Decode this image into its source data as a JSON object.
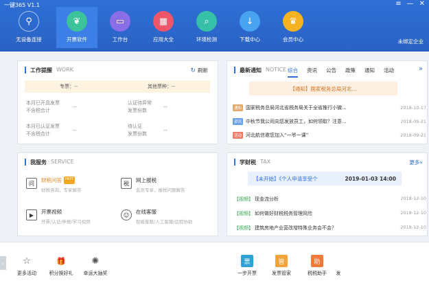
{
  "window": {
    "title": "一键365 V1.1",
    "controls": [
      "≡",
      "—",
      "✕"
    ]
  },
  "nav": [
    {
      "label": "无设备连接",
      "icon": "usb-icon",
      "color": "transparent"
    },
    {
      "label": "开票软件",
      "icon": "leaf-icon",
      "color": "#3cc39c"
    },
    {
      "label": "工作台",
      "icon": "monitor-icon",
      "color": "#8a6ee8"
    },
    {
      "label": "应用大全",
      "icon": "grid-icon",
      "color": "#f0566a"
    },
    {
      "label": "环境检测",
      "icon": "search-icon",
      "color": "#37c0a8"
    },
    {
      "label": "下载中心",
      "icon": "download-icon",
      "color": "#4aa3f0"
    },
    {
      "label": "会员中心",
      "icon": "vip-icon",
      "color": "#f5b321"
    }
  ],
  "user_status": "未绑定企业",
  "work": {
    "title": "工作提醒",
    "title_en": "WORK",
    "refresh": "刷新",
    "ticket_types": [
      "专票：--",
      "其他票种：--"
    ],
    "stats": [
      [
        "本月已开具发票",
        "不含税合计"
      ],
      [
        "认证待异常",
        "发票份数"
      ],
      [
        "本月已认证发票",
        "不含税合计"
      ],
      [
        "待认证",
        "发票份数"
      ]
    ],
    "dash": "--"
  },
  "service": {
    "title": "我服务",
    "title_en": "SERVICE",
    "hot": "HOT",
    "items": [
      {
        "name": "财税问答",
        "desc": "财税咨询，专家解答",
        "icon": "qa-icon",
        "glyph": "问"
      },
      {
        "name": "网上报税",
        "desc": "会员专享，报税问题解答",
        "icon": "tax-report-icon",
        "glyph": "税"
      },
      {
        "name": "开票视频",
        "desc": "开票/认证/申报/学习视频",
        "icon": "video-icon",
        "glyph": "▶"
      },
      {
        "name": "在线客服",
        "desc": "智能客服/人工客服/远程协助",
        "icon": "customer-service-icon",
        "glyph": "☺"
      }
    ]
  },
  "notice": {
    "title": "最新通知",
    "title_en": "NOTICE",
    "tabs": [
      "综合",
      "资讯",
      "公告",
      "政策",
      "通知",
      "活动"
    ],
    "chevron": "»",
    "banner": "【通知】国家税务总局河北...",
    "rows": [
      {
        "badge": "通知",
        "badge_color": "#e0a96d",
        "text": "国家税务总局河北省税务局关于全省推行小微...",
        "date": "2018-10-17"
      },
      {
        "badge": "资讯",
        "badge_color": "#6aa0e8",
        "text": "中秋节我公司向您发放员工，如何领取？注意...",
        "date": "2018-09-21"
      },
      {
        "badge": "活动",
        "badge_color": "#f07c6a",
        "text": "河北航信邀您加入“一爷一课”",
        "date": "2018-09-21"
      }
    ]
  },
  "tax": {
    "title": "学财税",
    "title_en": "TAX",
    "more": "更多»",
    "banner_left": "【未开始】《个人申请享受个",
    "banner_right": "2019-01-03 14:00",
    "rows": [
      {
        "cat": "【视频】",
        "text": "现金流分析",
        "date": "2018-12-10"
      },
      {
        "cat": "【视频】",
        "text": "如何做好财税税务管理风险",
        "date": "2018-12-10"
      },
      {
        "cat": "【视频】",
        "text": "建筑房地产业营改增特殊业务会不会？",
        "date": "2018-12-10"
      }
    ]
  },
  "bottom": {
    "arrow": "›",
    "left_items": [
      {
        "label": "更多活动",
        "icon": "star-icon",
        "glyph": "☆"
      },
      {
        "label": "积分换好礼",
        "icon": "gift-icon",
        "glyph": "🎁"
      },
      {
        "label": "幸运大抽奖",
        "icon": "wheel-icon",
        "glyph": "✺"
      }
    ],
    "right_items": [
      {
        "label": "一步开票",
        "icon": "invoice-icon",
        "color": "#2fa2d8",
        "glyph": "票"
      },
      {
        "label": "发票管家",
        "icon": "manager-icon",
        "color": "#f0a43a",
        "glyph": "管"
      },
      {
        "label": "税税助手",
        "icon": "assistant-icon",
        "color": "#f07a3a",
        "glyph": "助"
      },
      {
        "label": "发",
        "icon": "more-icon",
        "color": "transparent",
        "glyph": ""
      }
    ]
  }
}
